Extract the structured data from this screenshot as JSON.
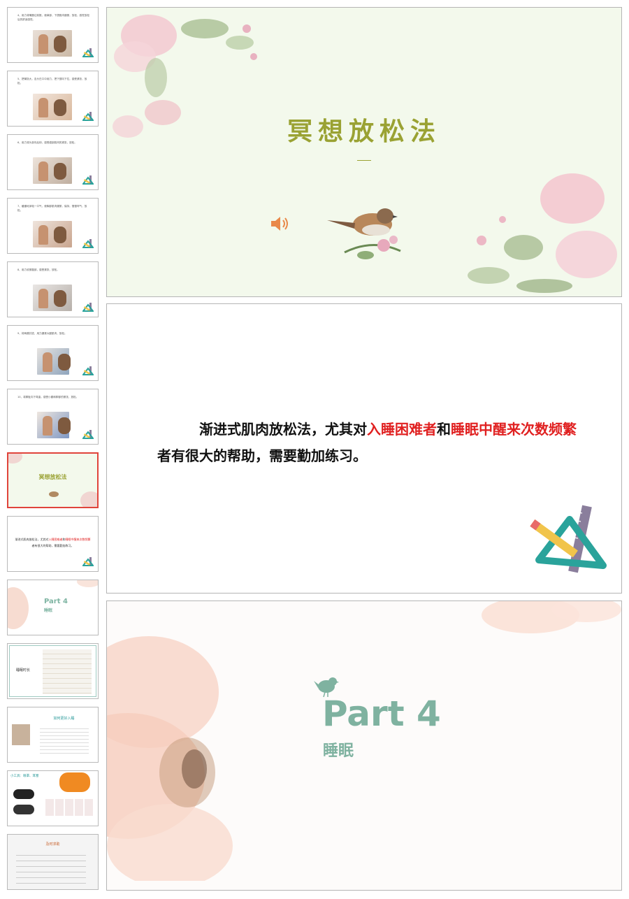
{
  "thumbnails": {
    "slide4_text": "4、用力将嘴唇往前推，使鼻部、下颌肌肉绷紧，放松，感觉放松后的舒适感觉。",
    "slide5_text": "5、把嘴张大，舌头在口中用力，把下颌向下拉，感受紧张，放松。",
    "slide6_text": "6、用力将头部向后仰，感受颈部肌肉的紧张，放松。",
    "slide7_text": "7、缓缓地深吸一口气，使胸部肌肉绷紧，保持，慢慢呼气，放松。",
    "slide8_text": "8、用力收紧腹部，感受紧张，放松。",
    "slide9_text": "9、将两膝并拢，用力绷紧大腿肌肉，放松。",
    "slide10_text": "10、将脚趾向下弯曲，感受小腿和脚部的紧张，放松。",
    "slide11_title": "冥想放松法",
    "slide12_text_a": "渐进式肌肉放松法，尤其对",
    "slide12_red_a": "入睡困难者",
    "slide12_text_b": "和",
    "slide12_red_b": "睡眠中醒来次数频繁",
    "slide12_text_c": "者有很大的帮助，需要勤加练习。",
    "slide13_part": "Part 4",
    "slide13_sub": "睡眠",
    "slide14_label": "睡眠时长",
    "slide15_title": "如何更好入睡",
    "slide16_title": "小工具：眼罩、耳塞",
    "slide17_title": "及时求助"
  },
  "slide_meditation": {
    "title": "冥想放松法"
  },
  "slide_pmr": {
    "text_a": "渐进式肌肉放松法，尤其对",
    "red_a": "入睡困难者",
    "text_b": "和",
    "red_b": "睡眠中醒来次数频繁",
    "text_c": "者有很大的帮助，需要勤加练习。"
  },
  "slide_part4": {
    "part_label": "Part 4",
    "subtitle": "睡眠"
  },
  "colors": {
    "accent_red": "#e02020",
    "olive_title": "#9aa233",
    "teal": "#7fb2a0",
    "selected_border": "#e0443b"
  }
}
